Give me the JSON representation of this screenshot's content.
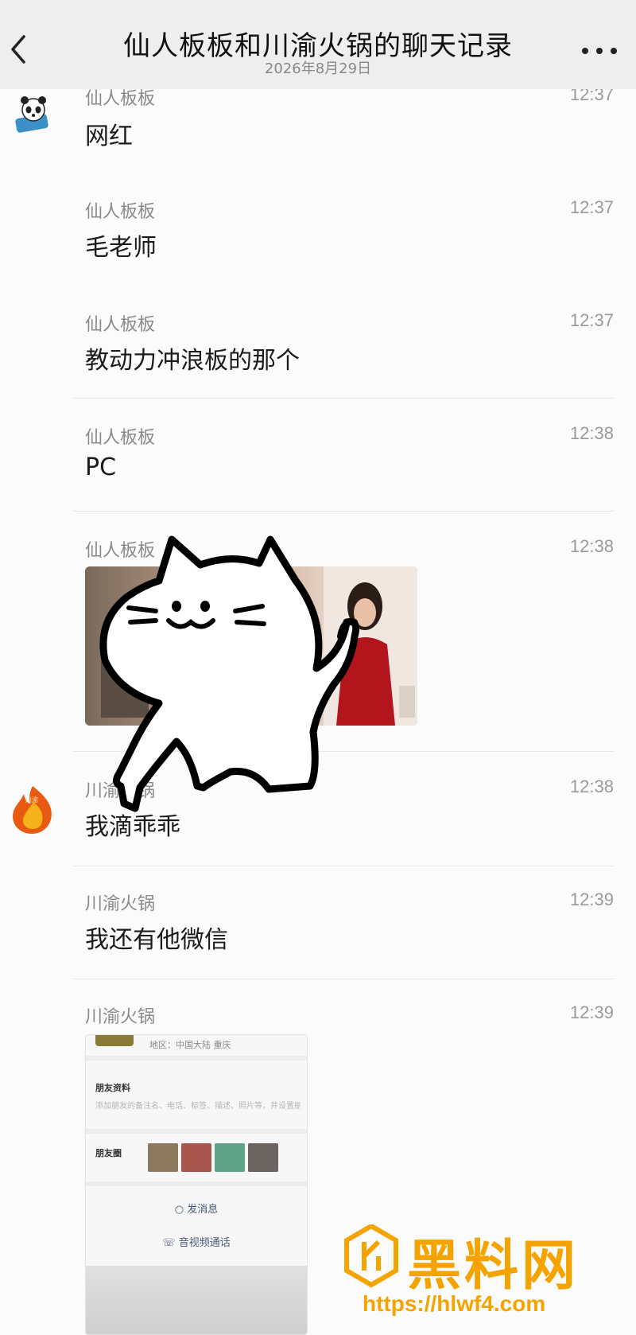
{
  "header": {
    "title": "仙人板板和川渝火锅的聊天记录",
    "date": "2026年8月29日"
  },
  "messages": [
    {
      "sender": "仙人板板",
      "time": "12:37",
      "text": "网红"
    },
    {
      "sender": "仙人板板",
      "time": "12:37",
      "text": "毛老师"
    },
    {
      "sender": "仙人板板",
      "time": "12:37",
      "text": "教动力冲浪板的那个"
    },
    {
      "sender": "仙人板板",
      "time": "12:38",
      "text": "PC"
    },
    {
      "sender": "仙人板板",
      "time": "12:38",
      "text": ""
    },
    {
      "sender": "川渝火锅",
      "time": "12:38",
      "text": "我滴乖乖"
    },
    {
      "sender": "川渝火锅",
      "time": "12:39",
      "text": "我还有他微信"
    },
    {
      "sender": "川渝火锅",
      "time": "12:39",
      "text": ""
    }
  ],
  "profile_card": {
    "region": "地区：中国大陆 重庆",
    "section_profile": "朋友资料",
    "profile_desc": "添加朋友的备注名、电话、标签、描述、照片等，并设置朋友权限。",
    "section_moments": "朋友圈",
    "send_message": "发消息",
    "video_call": "音视频通话"
  },
  "watermark": {
    "name": "黑料网",
    "url": "https://hlwf4.com"
  },
  "colors": {
    "header_bg": "#eeeeee",
    "watermark": "#f5a300"
  }
}
